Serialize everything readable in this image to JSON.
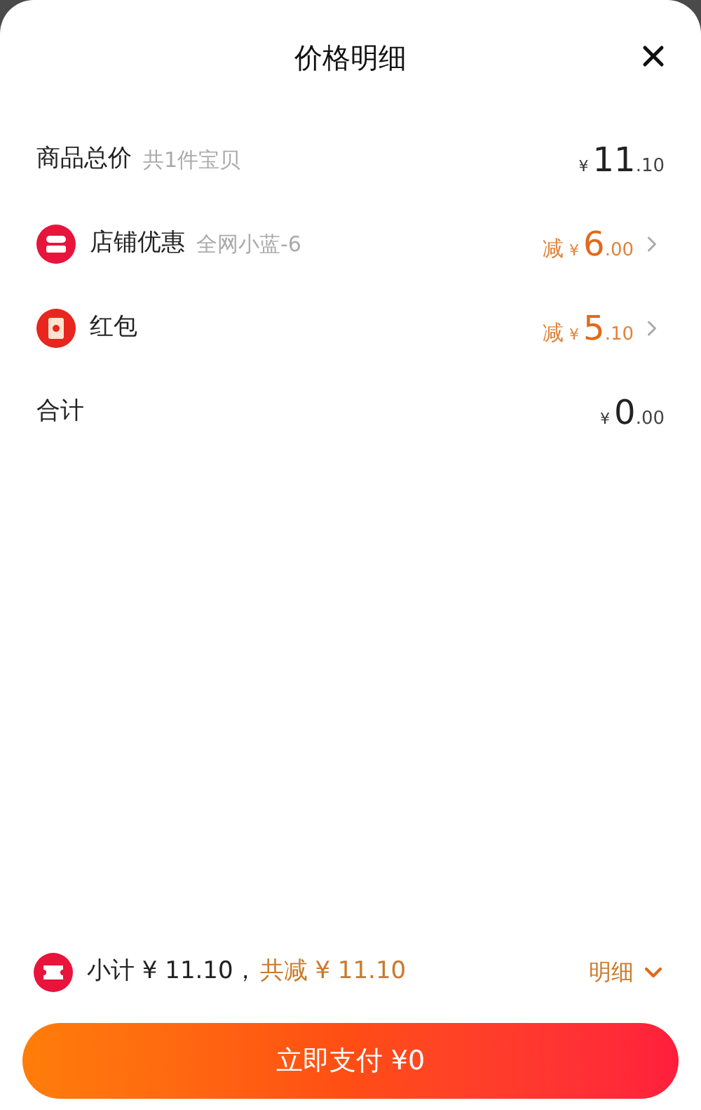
{
  "sheet": {
    "title": "价格明细"
  },
  "rows": [
    {
      "kind": "total",
      "label": "商品总价",
      "note": "共1件宝贝",
      "prefix": "",
      "currency": "¥",
      "amount": "11",
      "cents": ".10"
    },
    {
      "kind": "shop",
      "label": "店铺优惠",
      "note": "全网小蓝-6",
      "prefix": "减",
      "currency": "¥",
      "amount": "6",
      "cents": ".00"
    },
    {
      "kind": "packet",
      "label": "红包",
      "note": "",
      "prefix": "减",
      "currency": "¥",
      "amount": "5",
      "cents": ".10"
    },
    {
      "kind": "sum",
      "label": "合计",
      "note": "",
      "prefix": "",
      "currency": "¥",
      "amount": "0",
      "cents": ".00"
    }
  ],
  "footer": {
    "subtotal": "小计 ¥ 11.10，",
    "discount": "共减 ¥ 11.10",
    "details": "明细",
    "pay_button": "立即支付 ¥0"
  }
}
